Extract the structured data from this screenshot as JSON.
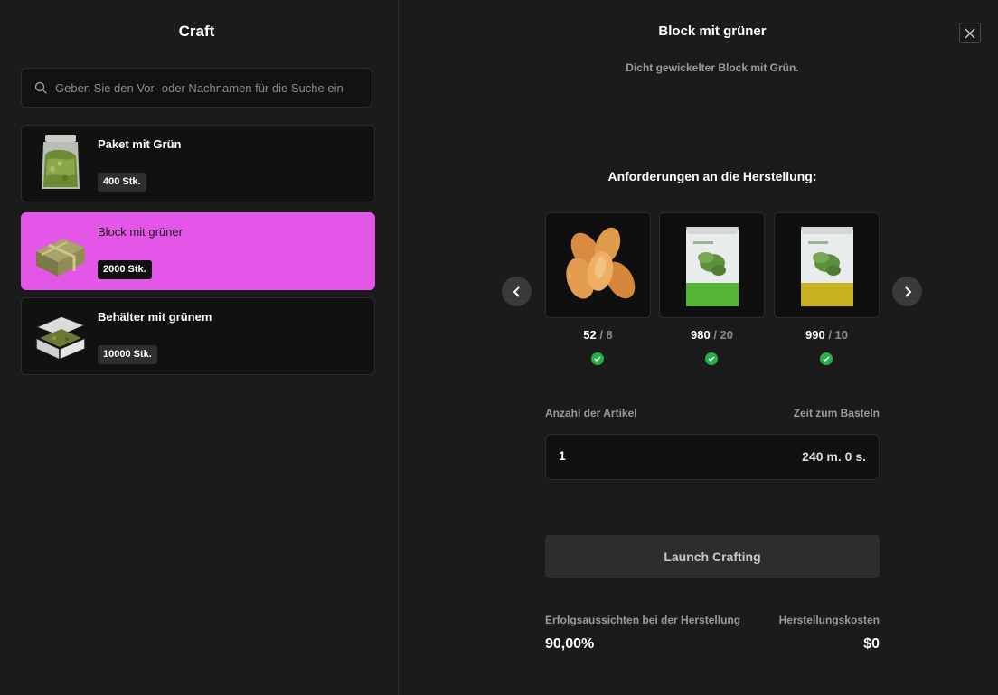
{
  "sidebar": {
    "title": "Craft",
    "search_placeholder": "Geben Sie den Vor- oder Nachnamen für die Suche ein",
    "items": [
      {
        "name": "Paket mit Grün",
        "qty": "400 Stk.",
        "icon": "green-bag-icon",
        "selected": false
      },
      {
        "name": "Block mit grüner",
        "qty": "2000 Stk.",
        "icon": "wrapped-block-icon",
        "selected": true
      },
      {
        "name": "Behälter mit grünem",
        "qty": "10000 Stk.",
        "icon": "open-case-icon",
        "selected": false
      }
    ]
  },
  "detail": {
    "title": "Block mit grüner",
    "subtitle": "Dicht gewickelter Block mit Grün.",
    "requirements_title": "Anforderungen an die Herstellung:",
    "requirements": [
      {
        "icon": "almonds-icon",
        "have": "52",
        "need": "/ 8",
        "ok": true
      },
      {
        "icon": "green-seed-pack-icon",
        "have": "980",
        "need": "/ 20",
        "ok": true
      },
      {
        "icon": "yellow-seed-pack-icon",
        "have": "990",
        "need": "/ 10",
        "ok": true
      }
    ],
    "amount_label": "Anzahl der Artikel",
    "time_label": "Zeit zum Basteln",
    "amount_value": "1",
    "time_value": "240 m. 0 s.",
    "launch_label": "Launch Crafting",
    "success_label": "Erfolgsaussichten bei der Herstellung",
    "cost_label": "Herstellungskosten",
    "success_value": "90,00%",
    "cost_value": "$0"
  },
  "colors": {
    "background": "#1b1b1b",
    "selected_item": "#e456e8",
    "ok_green": "#27b04a"
  }
}
